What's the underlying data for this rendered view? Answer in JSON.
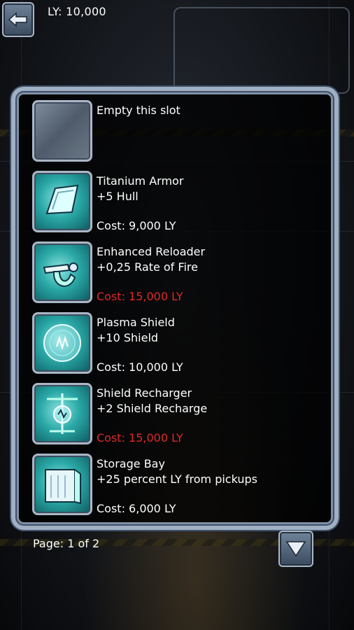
{
  "hud": {
    "ly_label": "LY: 10,000"
  },
  "items": [
    {
      "name": "Empty this slot",
      "bonus": "",
      "cost": "",
      "affordable": true,
      "icon": "empty-slot-icon"
    },
    {
      "name": "Titanium Armor",
      "bonus": "+5 Hull",
      "cost": "Cost: 9,000 LY",
      "affordable": true,
      "icon": "armor-plate-icon"
    },
    {
      "name": "Enhanced Reloader",
      "bonus": "+0,25 Rate of Fire",
      "cost": "Cost: 15,000 LY",
      "affordable": false,
      "icon": "reloader-icon"
    },
    {
      "name": "Plasma Shield",
      "bonus": "+10 Shield",
      "cost": "Cost: 10,000 LY",
      "affordable": true,
      "icon": "shield-orb-icon"
    },
    {
      "name": "Shield Recharger",
      "bonus": "+2 Shield Recharge",
      "cost": "Cost: 15,000 LY",
      "affordable": false,
      "icon": "recharger-icon"
    },
    {
      "name": "Storage Bay",
      "bonus": "+25 percent LY from pickups",
      "cost": "Cost: 6,000 LY",
      "affordable": true,
      "icon": "storage-bay-icon"
    }
  ],
  "pagination": {
    "label": "Page: 1 of 2"
  },
  "colors": {
    "unaffordable": "#e02828",
    "text": "#ffffff",
    "slot_teal": "#2aa8a6"
  }
}
